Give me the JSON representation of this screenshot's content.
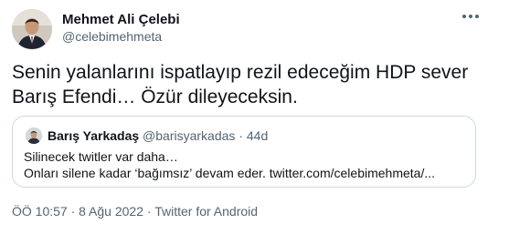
{
  "tweet": {
    "author": {
      "name": "Mehmet Ali Çelebi",
      "handle": "@celebimehmeta"
    },
    "text_line1": "Senin yalanlarını ispatlayıp rezil edeceğim HDP sever",
    "text_line2": "Barış Efendi… Özür dileyeceksin.",
    "quoted": {
      "name": "Barış Yarkadaş",
      "handle": "@barisyarkadas",
      "separator": "·",
      "time": "44d",
      "line1": "Silinecek twitler var daha…",
      "line2": "Onları silene kadar ‘bağımsız’ devam eder. twitter.com/celebimehmeta/..."
    },
    "time": "ÖÖ 10:57",
    "separator": "·",
    "date": "8 Ağu 2022",
    "source": "Twitter for Android"
  },
  "icons": {
    "more": "more-options-icon"
  },
  "colors": {
    "text_primary": "#0f1419",
    "text_secondary": "#536471",
    "border": "#cfd9de"
  }
}
